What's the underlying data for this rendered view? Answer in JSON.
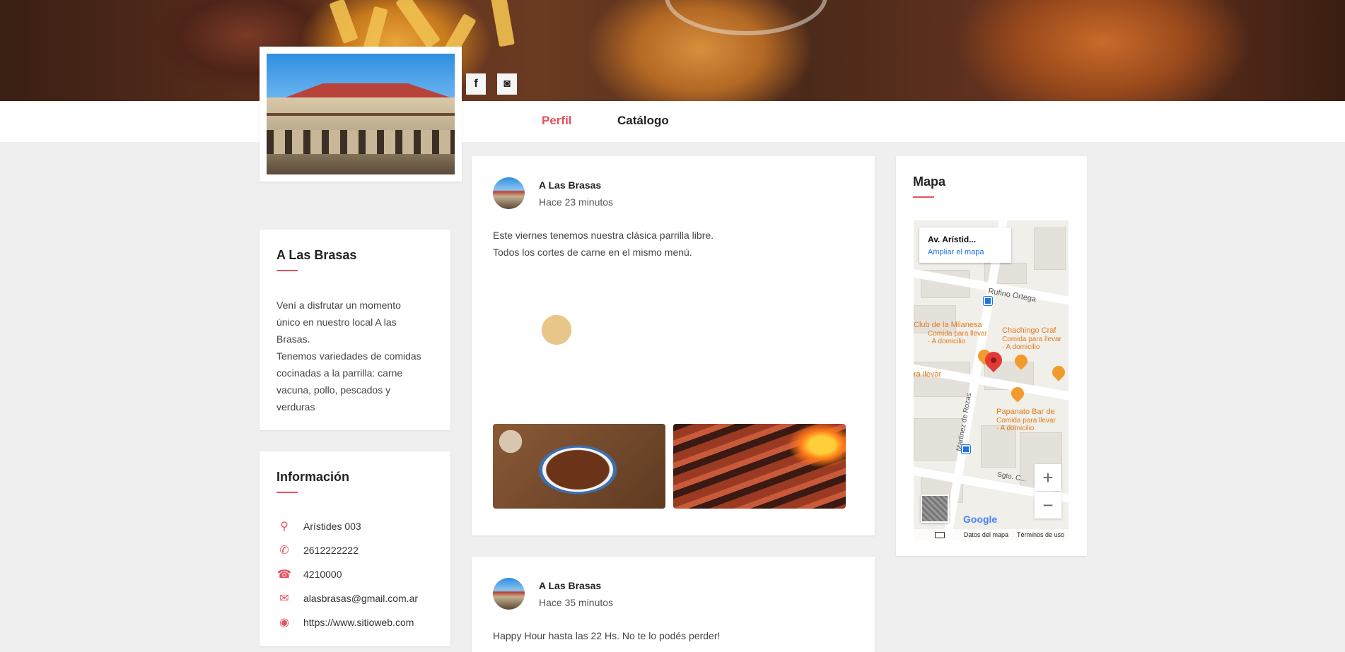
{
  "nav": {
    "tabs": [
      {
        "label": "Perfil"
      },
      {
        "label": "Catálogo"
      }
    ]
  },
  "social": {
    "facebook_glyph": "f",
    "instagram_glyph": "◙"
  },
  "about": {
    "title": "A Las Brasas",
    "text": "Vení a disfrutar un momento\núnico en nuestro local A las\nBrasas.\nTenemos variedades de comidas\ncocinadas a la parrilla: carne\nvacuna, pollo, pescados y\nverduras"
  },
  "info": {
    "title": "Información",
    "items": [
      {
        "icon": "location-pin-icon",
        "glyph": "⚲",
        "text": "Arístides 003"
      },
      {
        "icon": "whatsapp-icon",
        "glyph": "✆",
        "text": "2612222222"
      },
      {
        "icon": "phone-icon",
        "glyph": "☎",
        "text": "4210000"
      },
      {
        "icon": "envelope-icon",
        "glyph": "✉",
        "text": "alasbrasas@gmail.com.ar"
      },
      {
        "icon": "globe-icon",
        "glyph": "◉",
        "text": "https://www.sitioweb.com"
      }
    ]
  },
  "posts": [
    {
      "author": "A Las Brasas",
      "time": "Hace 23 minutos",
      "text": "Este viernes tenemos nuestra clásica parrilla libre.\nTodos los cortes de carne en el mismo menú."
    },
    {
      "author": "A Las Brasas",
      "time": "Hace 35 minutos",
      "text": "Happy Hour hasta las 22 Hs. No te lo podés perder!"
    }
  ],
  "map": {
    "title": "Mapa",
    "popup_title": "Av. Arístid...",
    "popup_link": "Ampliar el mapa",
    "street1": "Rufino Ortega",
    "street2": "Martinez de Rozas",
    "street3": "Sgto. C...",
    "poi1": "Club de la Milanesa",
    "poi1_sub": "Comida para llevar\n· A domicilio",
    "poi2": "Chachingo Craf",
    "poi2_sub": "Comida para llevar\n· A domicilio",
    "poi3": "ra llevar",
    "poi4": "Papanato Bar de",
    "poi4_sub": "Comida para llevar\n· A domicilio",
    "zoom_in": "+",
    "zoom_out": "−",
    "google": "Google",
    "footer_data": "Datos del mapa",
    "footer_terms": "Términos de uso"
  }
}
